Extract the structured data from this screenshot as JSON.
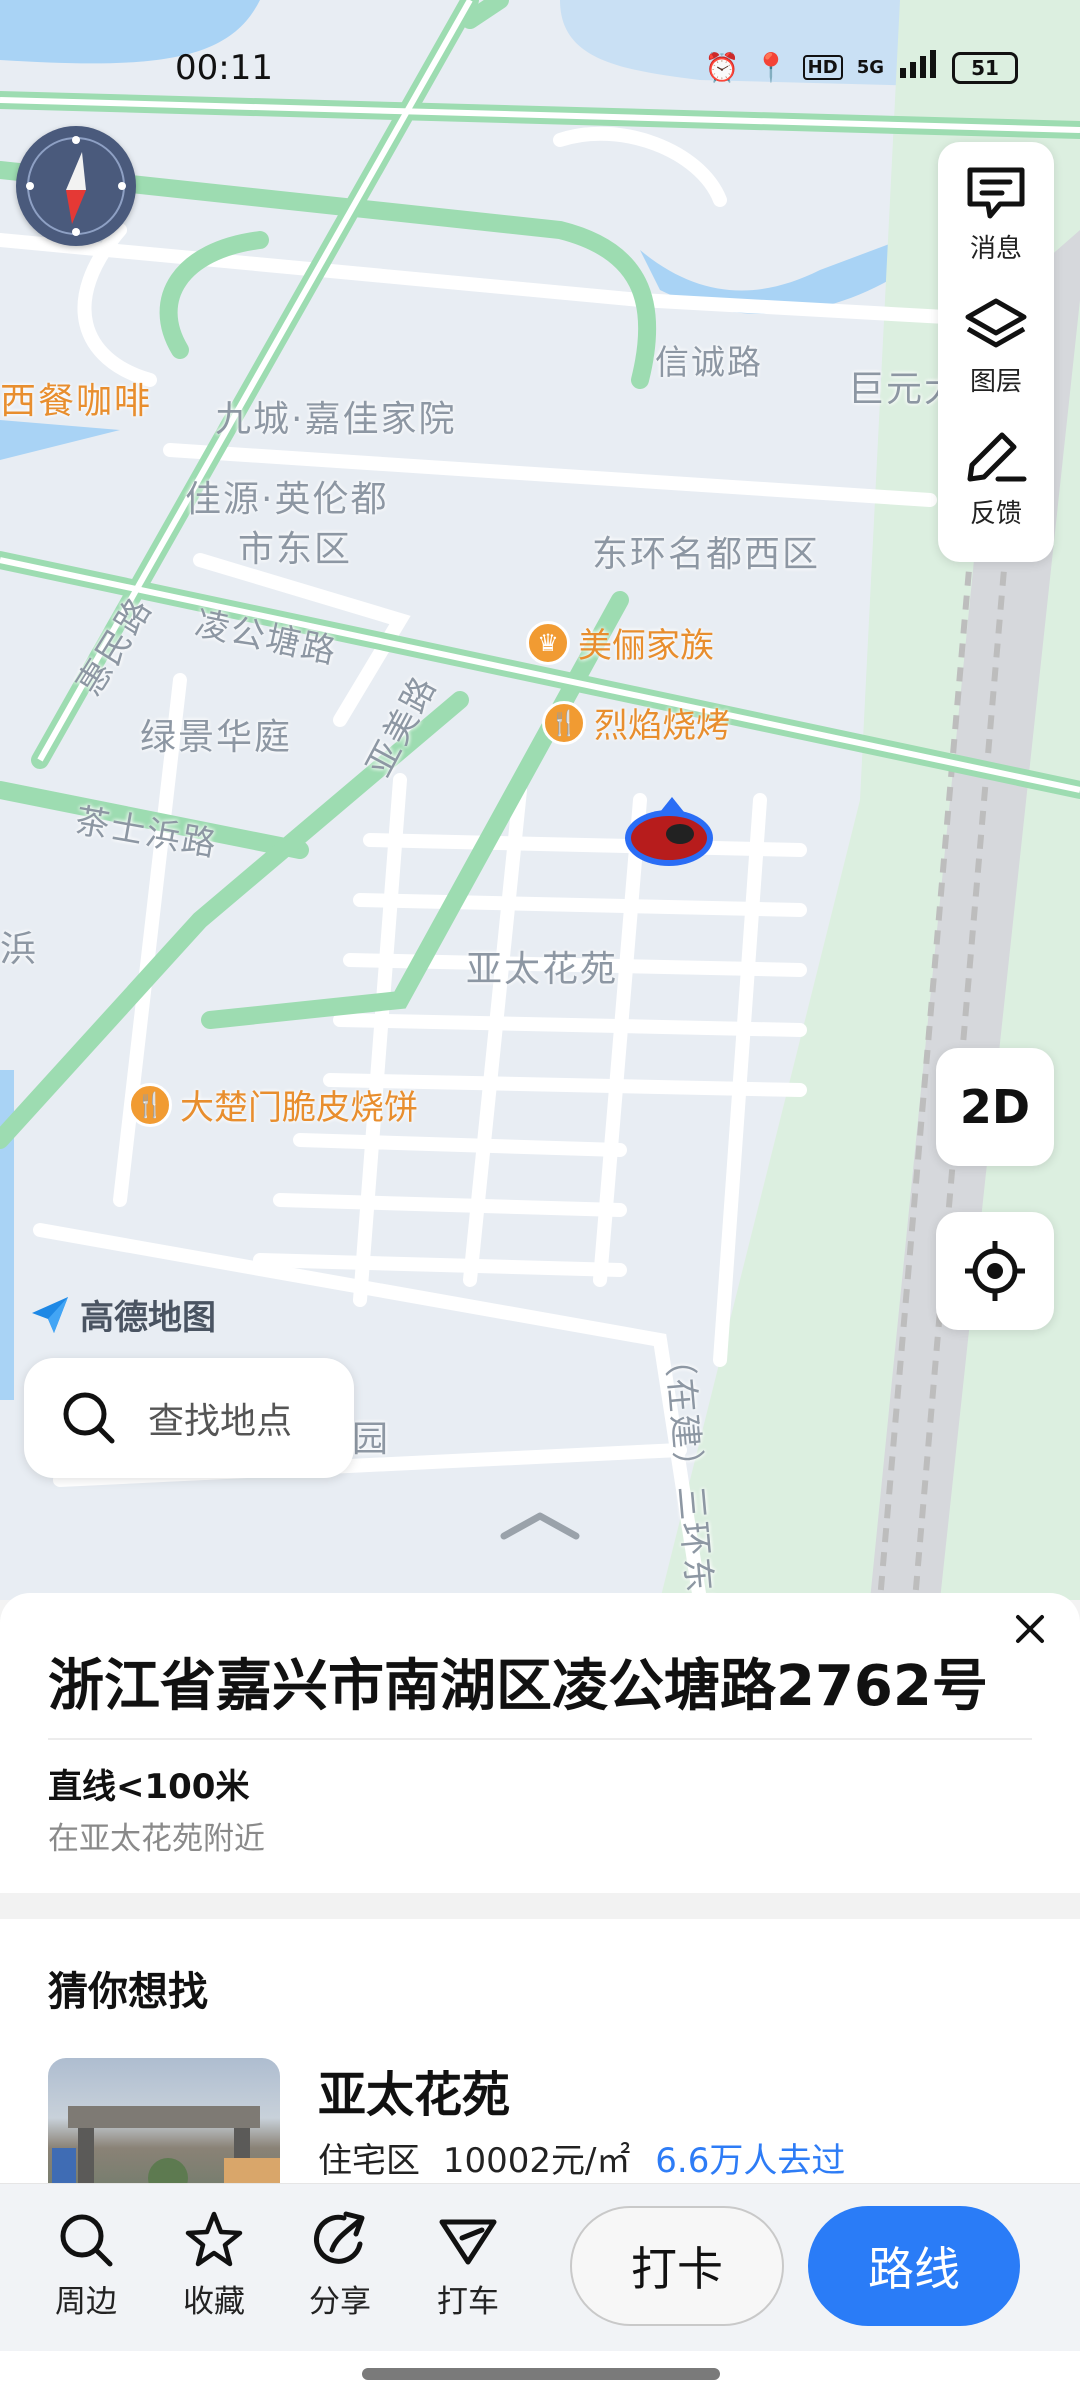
{
  "status_bar": {
    "time": "00:11",
    "network": "5G",
    "hd": "HD",
    "battery": "51"
  },
  "map": {
    "labels": {
      "western_cafe": "西餐咖啡",
      "jiucheng": "九城·嘉佳家院",
      "xincheng_rd": "信诚路",
      "juyuan": "巨元大",
      "jiayuan_1": "佳源·英伦都",
      "jiayuan_2": "市东区",
      "donghuan": "东环名都西区",
      "huimin_rd": "惠民路",
      "linggongtang_rd": "凌公塘路",
      "yamei_rd": "亚美路",
      "lvjing": "绿景华庭",
      "chashibang_rd": "茶士浜路",
      "bang": "浜",
      "yatai": "亚太花苑",
      "third_ring": "（在建）三环东路",
      "yuan": "园"
    },
    "pois": {
      "meili": "美俪家族",
      "lieyan": "烈焰烧烤",
      "dachumen": "大楚门脆皮烧饼"
    },
    "brand": "高德地图",
    "search_placeholder": "查找地点",
    "mode_2d": "2D"
  },
  "toolbar": {
    "messages": "消息",
    "layers": "图层",
    "feedback": "反馈"
  },
  "sheet": {
    "address": "浙江省嘉兴市南湖区凌公塘路2762号",
    "distance": "直线<100米",
    "nearby": "在亚太花苑附近",
    "guess_title": "猜你想找",
    "card": {
      "name": "亚太花苑",
      "type": "住宅区",
      "price": "10002元/㎡",
      "visits": "6.6万人去过"
    }
  },
  "actions": {
    "nearby": "周边",
    "favorite": "收藏",
    "share": "分享",
    "taxi": "打车",
    "checkin": "打卡",
    "route": "路线"
  },
  "colors": {
    "accent": "#2a7cf7",
    "poi": "#f19b32",
    "map_bg": "#e8edf3",
    "road_green": "#9ddcb1"
  }
}
